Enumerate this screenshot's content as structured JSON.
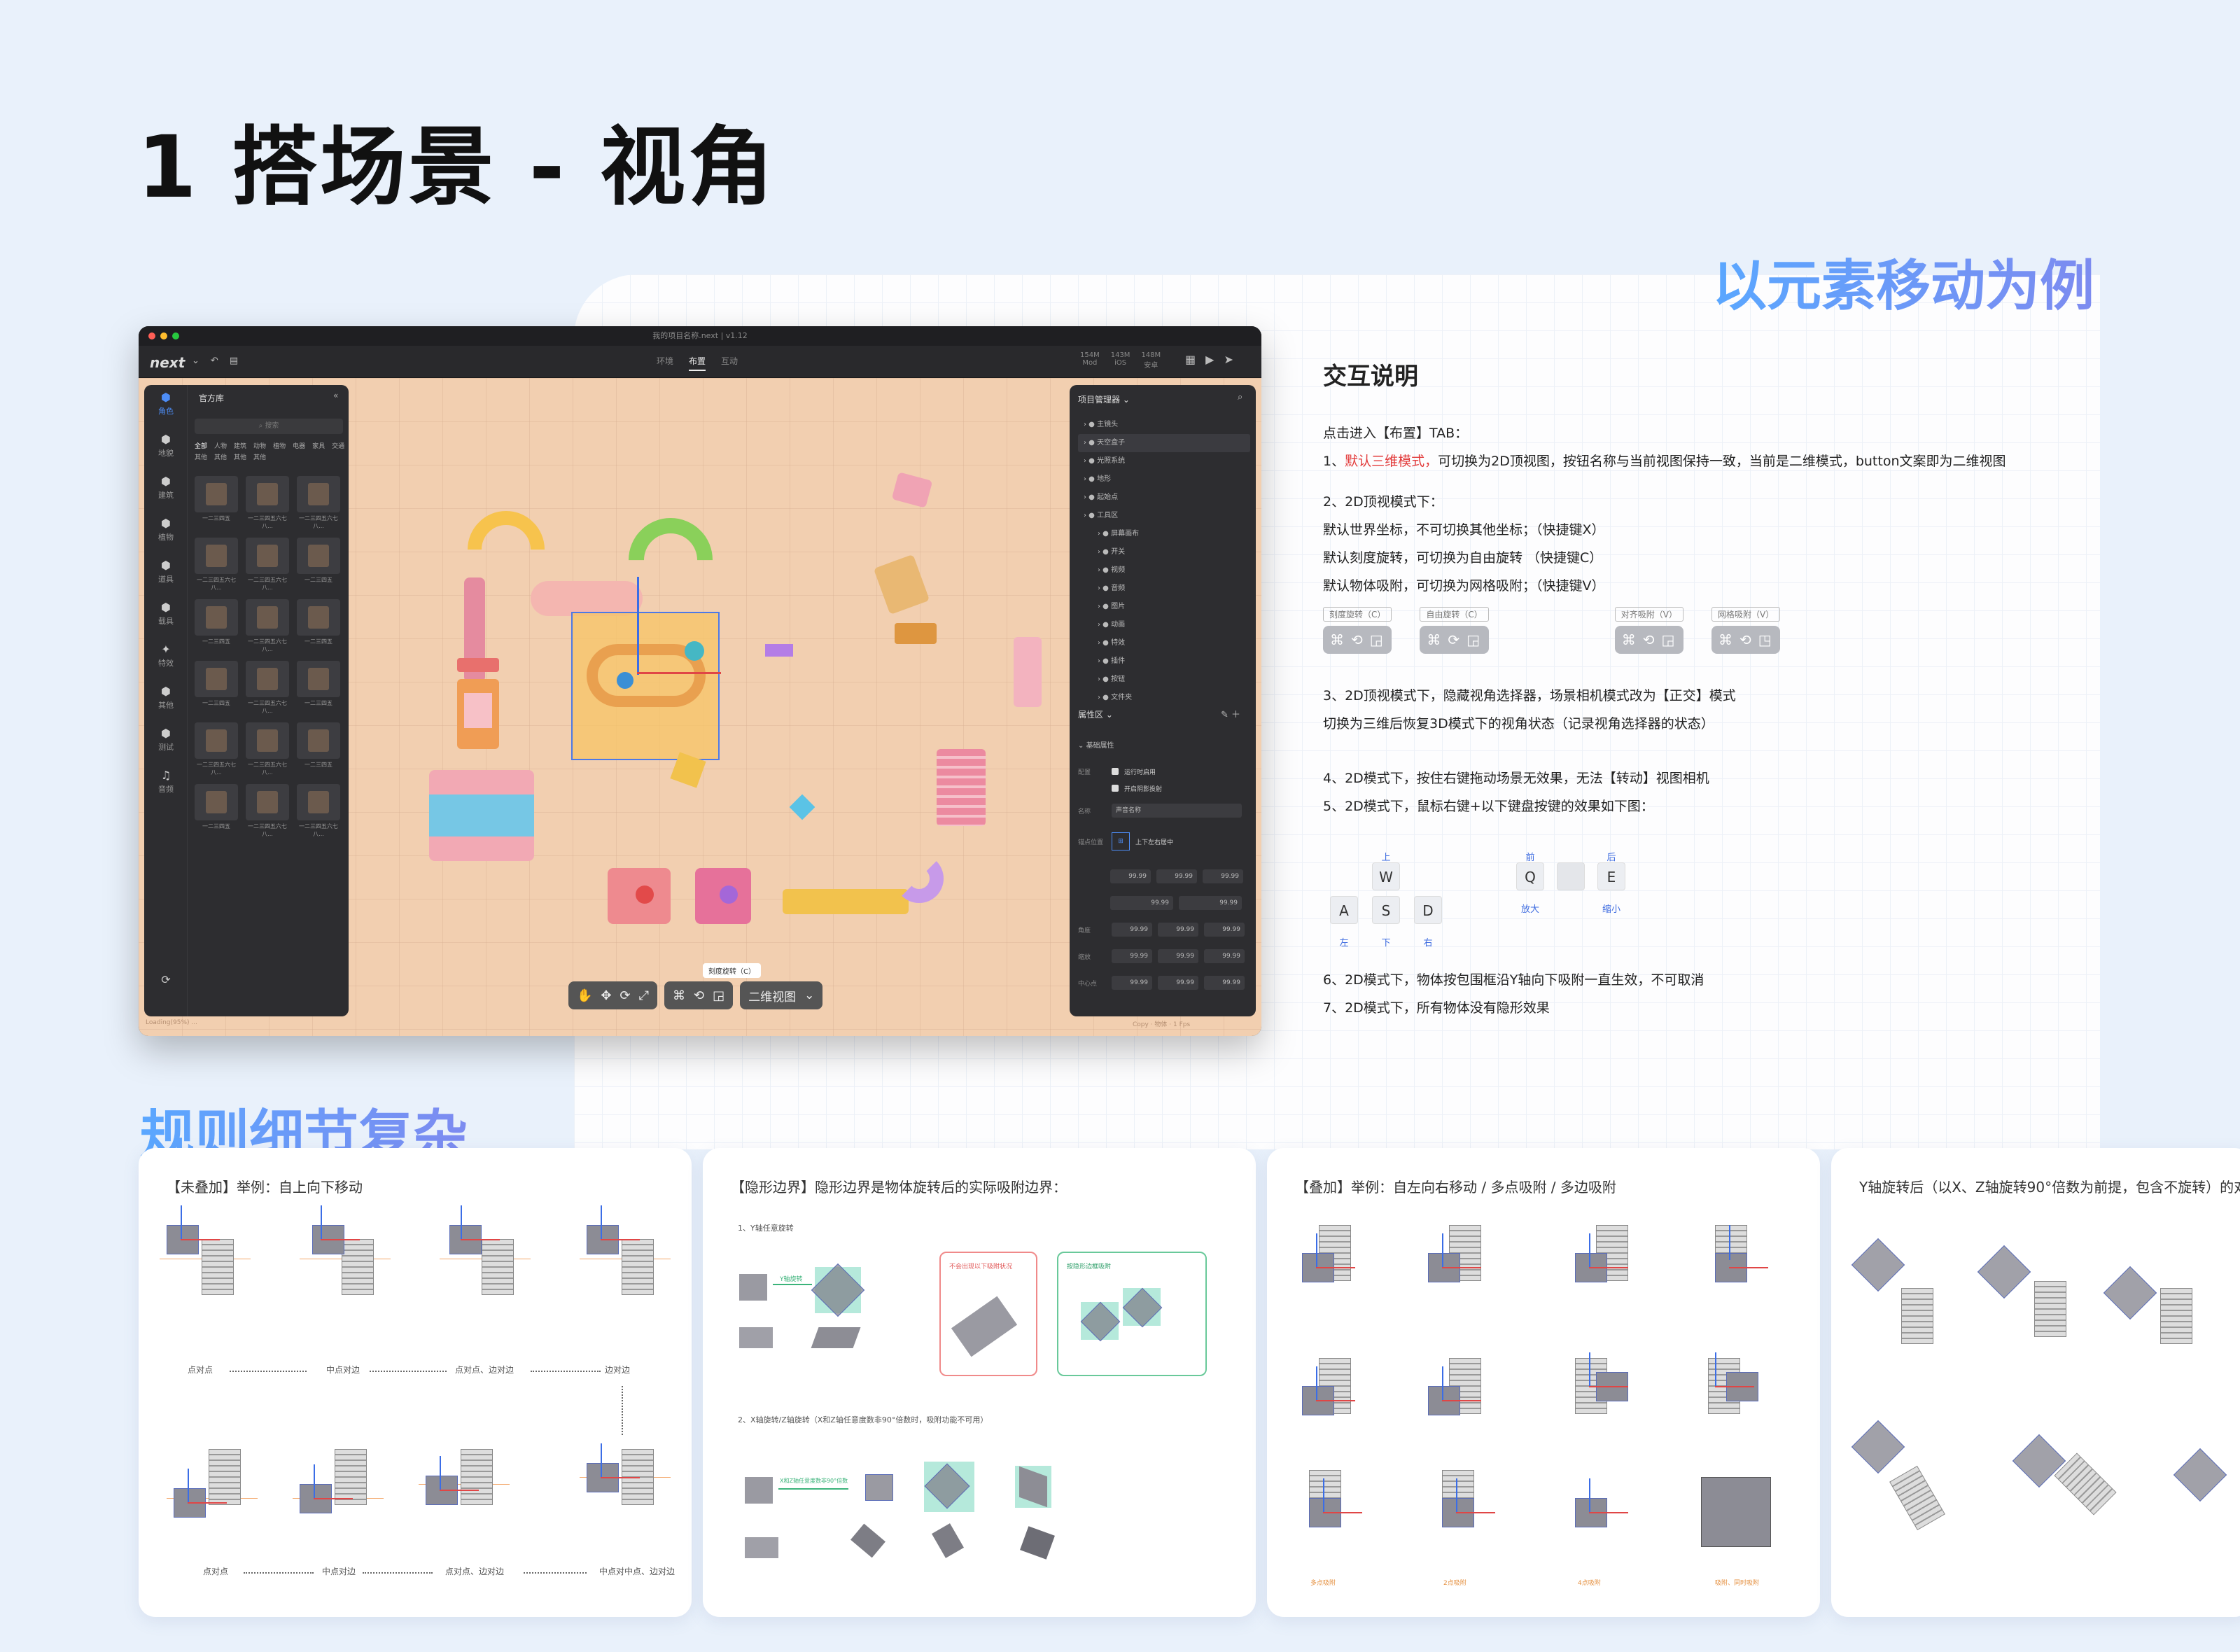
{
  "page": {
    "title": "1 搭场景 - 视角",
    "hero_subtitle": "以元素移动为例",
    "rules_title": "规则细节复杂"
  },
  "app": {
    "window_title": "我的项目名称.next  |  v1.12",
    "logo": "next",
    "tabs": [
      {
        "label": "环境"
      },
      {
        "label": "布置"
      },
      {
        "label": "互动"
      }
    ],
    "stats": [
      {
        "value": "154M",
        "label": "Mod"
      },
      {
        "value": "143M",
        "label": "iOS"
      },
      {
        "value": "148M",
        "label": "安卓"
      }
    ],
    "library": {
      "title": "官方库",
      "search_placeholder": "搜索",
      "rail": [
        {
          "label": "角色",
          "icon": "cube-icon"
        },
        {
          "label": "地貌",
          "icon": "cube-icon"
        },
        {
          "label": "建筑",
          "icon": "cube-icon"
        },
        {
          "label": "植物",
          "icon": "cube-icon"
        },
        {
          "label": "道具",
          "icon": "cube-icon"
        },
        {
          "label": "载具",
          "icon": "cube-icon"
        },
        {
          "label": "特效",
          "icon": "sparkle-icon"
        },
        {
          "label": "其他",
          "icon": "cube-icon"
        },
        {
          "label": "测试",
          "icon": "cube-icon"
        },
        {
          "label": "音频",
          "icon": "music-icon"
        }
      ],
      "categories": [
        "全部",
        "人物",
        "建筑",
        "动物",
        "植物",
        "电器",
        "家具",
        "交通",
        "其他",
        "其他",
        "其他",
        "其他"
      ],
      "items": [
        "一二三四五",
        "一二三四五六七八...",
        "一二三四五六七八...",
        "一二三四五六七八...",
        "一二三四五六七八...",
        "一二三四五",
        "一二三四五",
        "一二三四五六七八...",
        "一二三四五",
        "一二三四五",
        "一二三四五六七八...",
        "一二三四五",
        "一二三四五六七八...",
        "一二三四五六七八...",
        "一二三四五",
        "一二三四五",
        "一二三四五六七八...",
        "一二三四五六七八..."
      ]
    },
    "project": {
      "title": "项目管理器",
      "tree": [
        "主镜头",
        "天空盒子",
        "光照系统",
        "地形",
        "起始点",
        "工具区",
        "屏幕画布",
        "开关",
        "视频",
        "音频",
        "图片",
        "动画",
        "特效",
        "插件",
        "按钮",
        "文件夹"
      ],
      "properties_title": "属性区",
      "basic_props": "基础属性",
      "config_label": "配置",
      "run_enable": "运行时启用",
      "shadow": "开启阴影投射",
      "name_label": "名称",
      "name_value": "声音名称",
      "anchor_label": "锚点位置",
      "anchor_value": "上下左右居中",
      "value": "99.99",
      "angle_label": "角度",
      "scale_label": "缩放",
      "pivot_label": "中心点"
    },
    "bottom": {
      "tooltip": "刻度旋转（C）",
      "view_button": "二维视图"
    },
    "status_left": "Loading(95%)  ...",
    "status_right": "Copy  ·  物体  ·  1 Fps"
  },
  "doc": {
    "title": "交互说明",
    "line_1": "点击进入【布置】TAB：",
    "line_2_prefix": "1、",
    "line_2_red": "默认三维模式，",
    "line_2_rest": "可切换为2D顶视图，按钮名称与当前视图保持一致，当前是二维模式，button文案即为二维视图",
    "line_3": "2、2D顶视模式下：",
    "line_4": "默认世界坐标，不可切换其他坐标；（快捷键X）",
    "line_5": "默认刻度旋转，可切换为自由旋转  （快捷键C）",
    "line_6": "默认物体吸附，可切换为网格吸附；（快捷键V）",
    "btn_groups": [
      "刻度旋转（C）",
      "自由旋转（C）",
      "对齐吸附（V）",
      "网格吸附（V）"
    ],
    "line_7": "3、2D顶视模式下，隐藏视角选择器，场景相机模式改为【正交】模式",
    "line_8": "切换为三维后恢复3D模式下的视角状态（记录视角选择器的状态）",
    "line_9": "4、2D模式下，按住右键拖动场景无效果，无法【转动】视图相机",
    "line_10": "5、2D模式下，鼠标右键+以下键盘按键的效果如下图：",
    "keys": {
      "W": "W",
      "A": "A",
      "S": "S",
      "D": "D",
      "Q": "Q",
      "E": "E",
      "up": "上",
      "left": "左",
      "down": "下",
      "right": "右",
      "front": "前",
      "back": "后",
      "zoom_in": "放大",
      "zoom_out": "缩小"
    },
    "line_11": "6、2D模式下，物体按包围框沿Y轴向下吸附一直生效，不可取消",
    "line_12": "7、2D模式下，所有物体没有隐形效果"
  },
  "cards": [
    {
      "title": "【未叠加】举例：自上向下移动",
      "labels_top": [
        "点对点",
        "中点对边",
        "点对点、边对边",
        "边对边"
      ],
      "labels_bottom": [
        "点对点",
        "中点对边",
        "点对点、边对边",
        "中点对中点、边对边"
      ]
    },
    {
      "title": "【隐形边界】隐形边界是物体旋转后的实际吸附边界：",
      "sub_1": "1、Y轴任意旋转",
      "y_rotate_tag": "Y轴旋转",
      "red_note": "不会出现以下吸附状况",
      "green_note": "按隐形边框吸附",
      "sub_2": "2、X轴旋转/Z轴旋转（X和Z轴任意度数非90°倍数时，吸附功能不可用）",
      "xz_tag": "X和Z轴任意度数非90°倍数"
    },
    {
      "title": "【叠加】举例：自左向右移动 / 多点吸附 / 多边吸附",
      "labels": [
        "多点吸附",
        "2点吸附",
        "4点吸附",
        "吸附、同时吸附"
      ]
    },
    {
      "title": "Y轴旋转后（以X、Z轴旋转90°倍数为前提，包含不旋转）的对"
    }
  ]
}
